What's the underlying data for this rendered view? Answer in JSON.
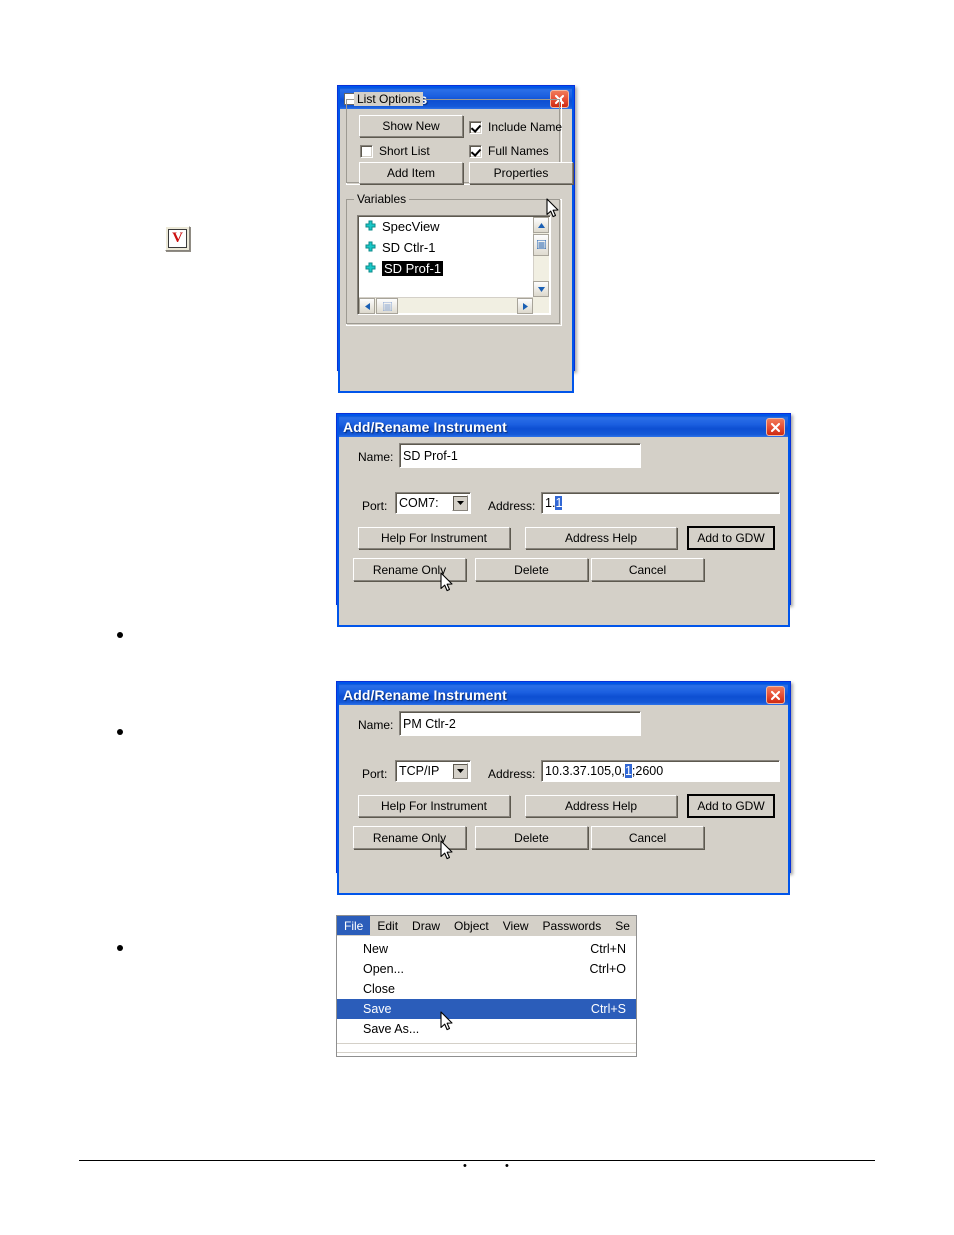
{
  "page": {
    "toolbar_button": {
      "glyph": "V",
      "name": "variables-toolbar-icon"
    },
    "footer_marks": [
      "•",
      "•"
    ]
  },
  "variables_dialog": {
    "title": "Variables",
    "icon": "window-icon",
    "close_label": "✕",
    "list_options": {
      "legend": "List Options",
      "show_new_label": "Show New",
      "add_item_label": "Add Item",
      "properties_label": "Properties",
      "short_list_label": "Short List",
      "short_list_checked": false,
      "include_name_label": "Include Name",
      "include_name_checked": true,
      "full_names_label": "Full Names",
      "full_names_checked": true
    },
    "variables": {
      "legend": "Variables",
      "items": [
        {
          "label": "SpecView",
          "selected": false
        },
        {
          "label": "SD Ctlr-1",
          "selected": false
        },
        {
          "label": "SD Prof-1",
          "selected": true
        }
      ]
    }
  },
  "instrument_dialog_1": {
    "title": "Add/Rename Instrument",
    "close_label": "✕",
    "name_label": "Name:",
    "name_value": "SD Prof-1",
    "port_label": "Port:",
    "port_value": "COM7:",
    "address_label": "Address:",
    "address_prefix": "1.",
    "address_selected": "1",
    "address_suffix": "",
    "buttons": {
      "help_for_instrument": "Help For Instrument",
      "address_help": "Address Help",
      "add_to_gdw": "Add to GDW",
      "rename_only": "Rename Only",
      "delete": "Delete",
      "cancel": "Cancel"
    }
  },
  "instrument_dialog_2": {
    "title": "Add/Rename Instrument",
    "close_label": "✕",
    "name_label": "Name:",
    "name_value": "PM Ctlr-2",
    "port_label": "Port:",
    "port_value": "TCP/IP",
    "address_label": "Address:",
    "address_prefix": "10.3.37.105,0,",
    "address_selected": "1",
    "address_suffix": ";2600",
    "buttons": {
      "help_for_instrument": "Help For Instrument",
      "address_help": "Address Help",
      "add_to_gdw": "Add to GDW",
      "rename_only": "Rename Only",
      "delete": "Delete",
      "cancel": "Cancel"
    }
  },
  "file_menu": {
    "menubar": [
      {
        "label": "File",
        "active": true
      },
      {
        "label": "Edit",
        "active": false
      },
      {
        "label": "Draw",
        "active": false
      },
      {
        "label": "Object",
        "active": false
      },
      {
        "label": "View",
        "active": false
      },
      {
        "label": "Passwords",
        "active": false
      },
      {
        "label": "Se",
        "active": false
      }
    ],
    "items": [
      {
        "label": "New",
        "accel": "Ctrl+N",
        "selected": false
      },
      {
        "label": "Open...",
        "accel": "Ctrl+O",
        "selected": false
      },
      {
        "label": "Close",
        "accel": "",
        "selected": false
      },
      {
        "label": "Save",
        "accel": "Ctrl+S",
        "selected": true
      },
      {
        "label": "Save As...",
        "accel": "",
        "selected": false
      }
    ]
  }
}
